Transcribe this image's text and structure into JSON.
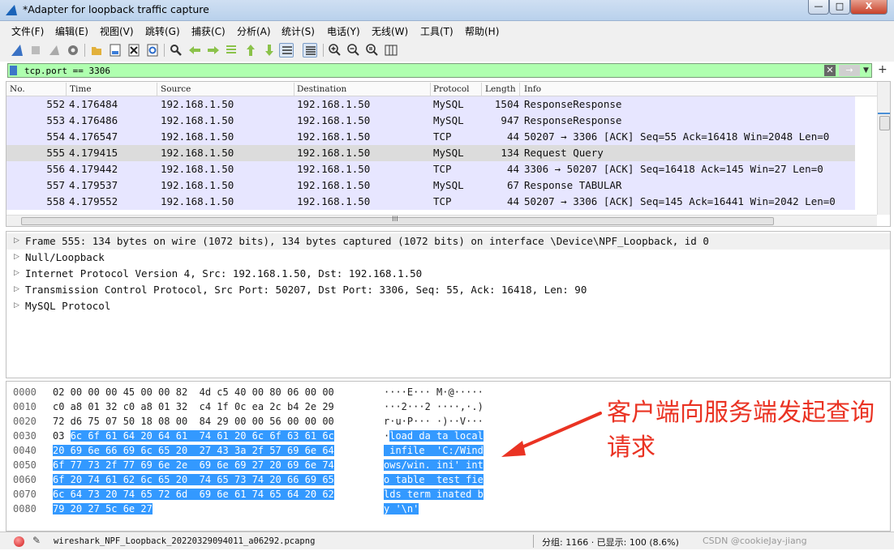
{
  "window": {
    "title": "*Adapter for loopback traffic capture",
    "minimize": "—",
    "maximize": "□",
    "close": "X"
  },
  "menu": [
    "文件(F)",
    "编辑(E)",
    "视图(V)",
    "跳转(G)",
    "捕获(C)",
    "分析(A)",
    "统计(S)",
    "电话(Y)",
    "无线(W)",
    "工具(T)",
    "帮助(H)"
  ],
  "toolbar": {
    "icons": [
      "shark-fin-start-icon",
      "stop-icon",
      "restart-icon",
      "options-gear-icon",
      "open-file-icon",
      "save-file-icon",
      "close-file-icon",
      "reload-icon",
      "find-icon",
      "go-back-icon",
      "go-forward-icon",
      "go-to-packet-icon",
      "go-first-icon",
      "go-last-icon",
      "autoscroll-icon",
      "colorize-icon",
      "zoom-in-icon",
      "zoom-out-icon",
      "zoom-normal-icon",
      "resize-columns-icon"
    ]
  },
  "filter": {
    "value": "tcp.port == 3306",
    "clear": "✕",
    "apply": "→",
    "dropdown": "▼",
    "add": "+"
  },
  "packet_list": {
    "columns": [
      "No.",
      "Time",
      "Source",
      "Destination",
      "Protocol",
      "Length",
      "Info"
    ],
    "rows": [
      {
        "no": "552",
        "time": "4.176484",
        "source": "192.168.1.50",
        "destination": "192.168.1.50",
        "protocol": "MySQL",
        "length": "1504",
        "info": "ResponseResponse",
        "selected": false
      },
      {
        "no": "553",
        "time": "4.176486",
        "source": "192.168.1.50",
        "destination": "192.168.1.50",
        "protocol": "MySQL",
        "length": "947",
        "info": "ResponseResponse",
        "selected": false
      },
      {
        "no": "554",
        "time": "4.176547",
        "source": "192.168.1.50",
        "destination": "192.168.1.50",
        "protocol": "TCP",
        "length": "44",
        "info": "50207 → 3306 [ACK] Seq=55 Ack=16418 Win=2048 Len=0",
        "selected": false
      },
      {
        "no": "555",
        "time": "4.179415",
        "source": "192.168.1.50",
        "destination": "192.168.1.50",
        "protocol": "MySQL",
        "length": "134",
        "info": "Request Query",
        "selected": true
      },
      {
        "no": "556",
        "time": "4.179442",
        "source": "192.168.1.50",
        "destination": "192.168.1.50",
        "protocol": "TCP",
        "length": "44",
        "info": "3306 → 50207 [ACK] Seq=16418 Ack=145 Win=27 Len=0",
        "selected": false
      },
      {
        "no": "557",
        "time": "4.179537",
        "source": "192.168.1.50",
        "destination": "192.168.1.50",
        "protocol": "MySQL",
        "length": "67",
        "info": "Response TABULAR",
        "selected": false
      },
      {
        "no": "558",
        "time": "4.179552",
        "source": "192.168.1.50",
        "destination": "192.168.1.50",
        "protocol": "TCP",
        "length": "44",
        "info": "50207 → 3306 [ACK] Seq=145 Ack=16441 Win=2042 Len=0",
        "selected": false
      }
    ],
    "hscroll_mark": "III"
  },
  "details": [
    "Frame 555: 134 bytes on wire (1072 bits), 134 bytes captured (1072 bits) on interface \\Device\\NPF_Loopback, id 0",
    "Null/Loopback",
    "Internet Protocol Version 4, Src: 192.168.1.50, Dst: 192.168.1.50",
    "Transmission Control Protocol, Src Port: 50207, Dst Port: 3306, Seq: 55, Ack: 16418, Len: 90",
    "MySQL Protocol"
  ],
  "bytes": [
    {
      "offset": "0000",
      "hex_plain": "02 00 00 00 45 00 00 82  4d c5 40 00 80 06 00 00",
      "hex_hl": "",
      "ascii_plain": "····E··· M·@·····",
      "ascii_hl": ""
    },
    {
      "offset": "0010",
      "hex_plain": "c0 a8 01 32 c0 a8 01 32  c4 1f 0c ea 2c b4 2e 29",
      "hex_hl": "",
      "ascii_plain": "···2···2 ····,·.)",
      "ascii_hl": ""
    },
    {
      "offset": "0020",
      "hex_plain": "72 d6 75 07 50 18 08 00  84 29 00 00 56 00 00 00",
      "hex_hl": "",
      "ascii_plain": "r·u·P··· ·)··V···",
      "ascii_hl": ""
    },
    {
      "offset": "0030",
      "hex_plain": "03 ",
      "hex_hl": "6c 6f 61 64 20 64 61  74 61 20 6c 6f 63 61 6c",
      "ascii_plain": "·",
      "ascii_hl": "load da ta local"
    },
    {
      "offset": "0040",
      "hex_plain": "",
      "hex_hl": "20 69 6e 66 69 6c 65 20  27 43 3a 2f 57 69 6e 64",
      "ascii_plain": "",
      "ascii_hl": " infile  'C:/Wind"
    },
    {
      "offset": "0050",
      "hex_plain": "",
      "hex_hl": "6f 77 73 2f 77 69 6e 2e  69 6e 69 27 20 69 6e 74",
      "ascii_plain": "",
      "ascii_hl": "ows/win. ini' int"
    },
    {
      "offset": "0060",
      "hex_plain": "",
      "hex_hl": "6f 20 74 61 62 6c 65 20  74 65 73 74 20 66 69 65",
      "ascii_plain": "",
      "ascii_hl": "o table  test fie"
    },
    {
      "offset": "0070",
      "hex_plain": "",
      "hex_hl": "6c 64 73 20 74 65 72 6d  69 6e 61 74 65 64 20 62",
      "ascii_plain": "",
      "ascii_hl": "lds term inated b"
    },
    {
      "offset": "0080",
      "hex_plain": "",
      "hex_hl": "79 20 27 5c 6e 27",
      "ascii_plain": "",
      "ascii_hl": "y '\\n'"
    }
  ],
  "annotation": "客户端向服务端发起查询请求",
  "status": {
    "file": "wireshark_NPF_Loopback_20220329094011_a06292.pcapng",
    "stats": "分组: 1166 · 已显示: 100 (8.6%)",
    "trailing": "CSDN @cookieJay-jiang",
    "comment_icon": "✎"
  },
  "colors": {
    "row_bg": "#e7e6ff",
    "row_selected": "#dcdcdc",
    "filter_ok": "#afffaf",
    "byte_highlight": "#3399ff",
    "annotation": "#ea3323"
  }
}
